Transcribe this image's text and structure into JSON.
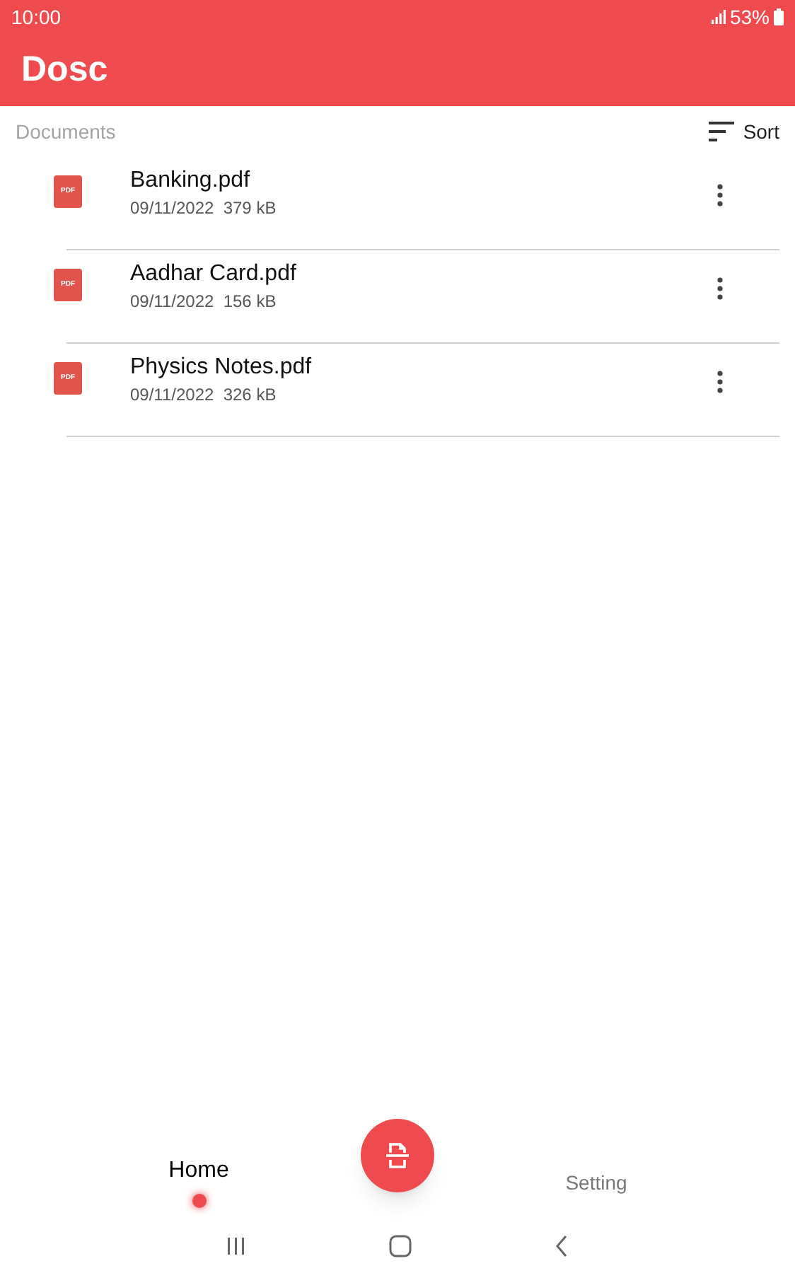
{
  "status_bar": {
    "time": "10:00",
    "battery": "53%"
  },
  "app_bar": {
    "title": "Dosc"
  },
  "section": {
    "title": "Documents",
    "sort_label": "Sort"
  },
  "documents": [
    {
      "name": "Banking.pdf",
      "date": "09/11/2022",
      "size": "379 kB",
      "icon_label": "PDF"
    },
    {
      "name": "Aadhar Card.pdf",
      "date": "09/11/2022",
      "size": "156 kB",
      "icon_label": "PDF"
    },
    {
      "name": "Physics Notes.pdf",
      "date": "09/11/2022",
      "size": "326 kB",
      "icon_label": "PDF"
    }
  ],
  "bottom_nav": [
    {
      "label": "Home",
      "selected": true
    },
    {
      "label": "Setting",
      "selected": false
    }
  ]
}
